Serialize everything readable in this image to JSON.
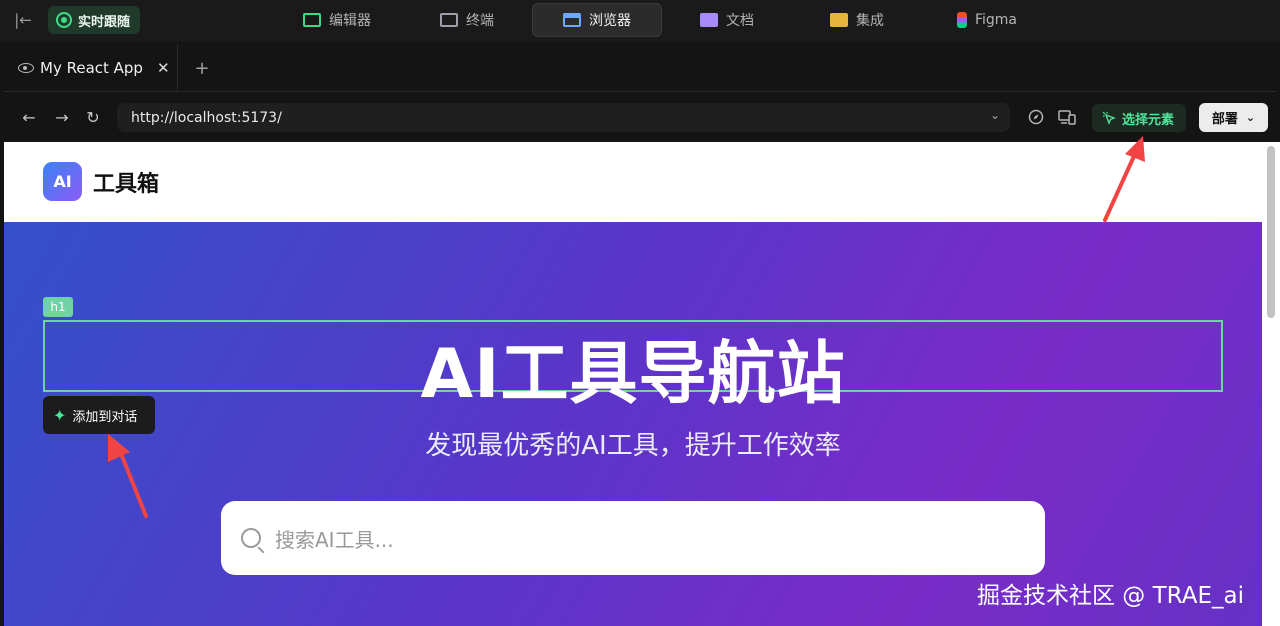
{
  "topbar": {
    "live_label": "实时跟随",
    "tabs": [
      {
        "label": "编辑器",
        "icon": "editor-icon"
      },
      {
        "label": "终端",
        "icon": "terminal-icon"
      },
      {
        "label": "浏览器",
        "icon": "browser-icon"
      },
      {
        "label": "文档",
        "icon": "docs-icon"
      },
      {
        "label": "集成",
        "icon": "integration-icon"
      },
      {
        "label": "Figma",
        "icon": "figma-icon"
      }
    ],
    "active_tab": "浏览器"
  },
  "browser": {
    "tab_title": "My React App",
    "url": "http://localhost:5173/",
    "select_element_label": "选择元素",
    "deploy_label": "部署"
  },
  "site": {
    "logo_text": "AI",
    "brand": "工具箱",
    "element_tag": "h1",
    "hero_title": "AI工具导航站",
    "add_to_chat": "添加到对话",
    "hero_subtitle": "发现最优秀的AI工具，提升工作效率",
    "search_placeholder": "搜索AI工具..."
  },
  "annotation": {
    "arrow_color": "#f24444",
    "highlight_color": "#6fd3a6"
  },
  "watermark": "掘金技术社区 @ TRAE_ai"
}
